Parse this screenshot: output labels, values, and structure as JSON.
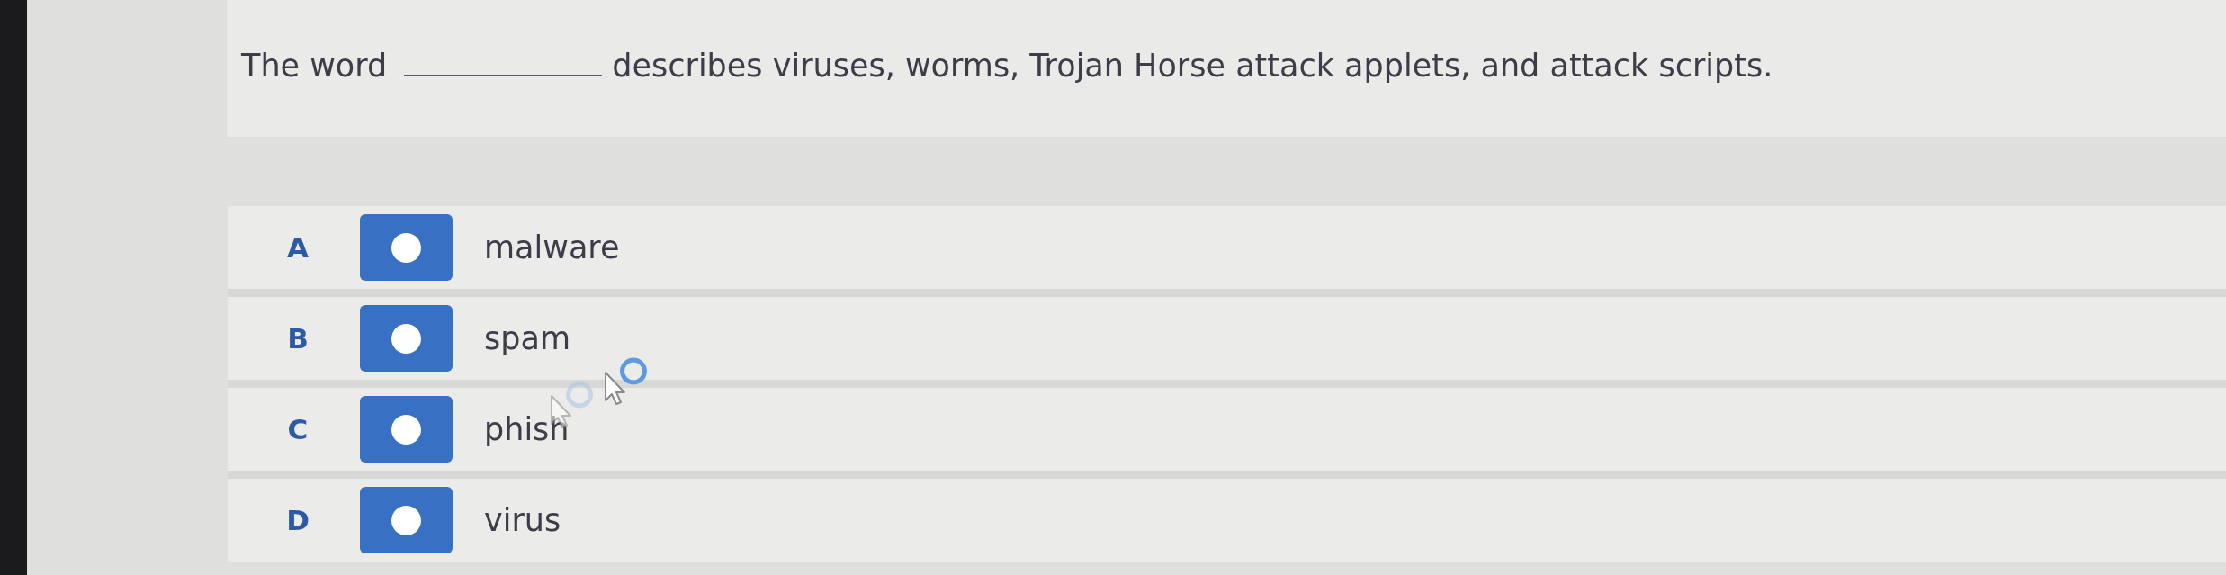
{
  "question": {
    "text_before": "The word",
    "text_after": "describes viruses, worms, Trojan Horse attack applets, and attack scripts."
  },
  "options": [
    {
      "letter": "A",
      "label": "malware",
      "selected": false
    },
    {
      "letter": "B",
      "label": "spam",
      "selected": false
    },
    {
      "letter": "C",
      "label": "phish",
      "selected": false
    },
    {
      "letter": "D",
      "label": "virus",
      "selected": false
    }
  ]
}
